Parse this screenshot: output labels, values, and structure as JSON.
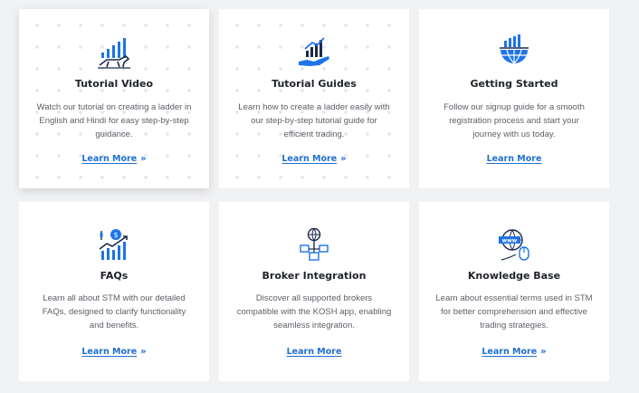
{
  "colors": {
    "accent": "#1f6fd1",
    "icon_blue": "#1e73e8",
    "icon_dark": "#1b2a4a",
    "background": "#f1f2f4"
  },
  "cards": [
    {
      "title": "Tutorial Video",
      "description": "Watch our tutorial on creating a ladder in English and Hindi for easy step-by-step guidance.",
      "link": "Learn More",
      "link_icon": "double-chevron-right",
      "icon": "bull-chart-icon"
    },
    {
      "title": "Tutorial Guides",
      "description": "Learn how to create a ladder easily with our step-by-step tutorial guide for efficient trading.",
      "link": "Learn More",
      "link_icon": "double-chevron-right",
      "icon": "hand-chart-icon"
    },
    {
      "title": "Getting Started",
      "description": "Follow our signup guide for a smooth registration process and start your journey with us today.",
      "link": "Learn More",
      "icon": "globe-chart-icon"
    },
    {
      "title": "FAQs",
      "description": "Learn all about STM with our detailed FAQs, designed to clarify functionality and benefits.",
      "link": "Learn More",
      "link_icon": "double-chevron-right",
      "icon": "coin-growth-icon"
    },
    {
      "title": "Broker Integration",
      "description": "Discover all supported brokers compatible with the KOSH app, enabling seamless integration.",
      "link": "Learn More",
      "icon": "network-integration-icon"
    },
    {
      "title": "Knowledge Base",
      "description": "Learn about essential terms used in STM for better comprehension and effective trading strategies.",
      "link": "Learn More",
      "link_icon": "double-chevron-right",
      "icon": "www-mouse-icon"
    }
  ]
}
